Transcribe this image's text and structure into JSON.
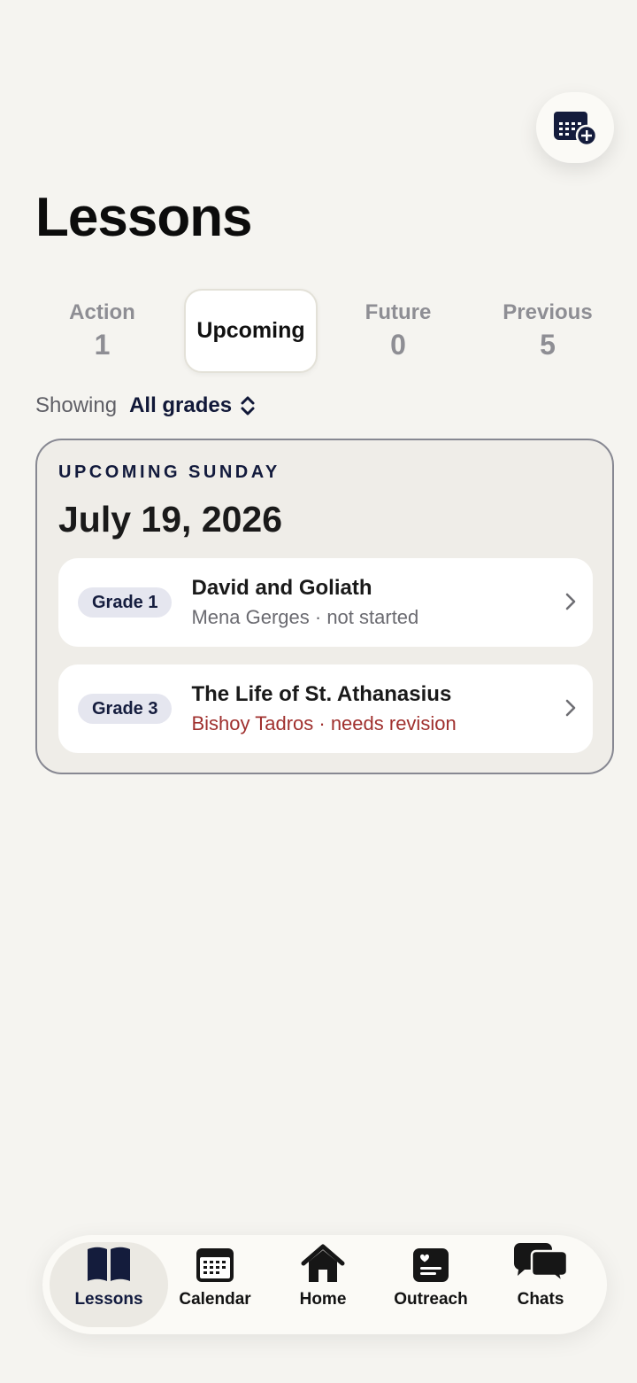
{
  "page": {
    "title": "Lessons"
  },
  "tabs": [
    {
      "label": "Action",
      "count": "1"
    },
    {
      "label": "Upcoming",
      "count": ""
    },
    {
      "label": "Future",
      "count": "0"
    },
    {
      "label": "Previous",
      "count": "5"
    }
  ],
  "filter": {
    "prefix": "Showing",
    "value": "All grades"
  },
  "upcoming": {
    "eyebrow": "UPCOMING SUNDAY",
    "date": "July 19, 2026",
    "lessons": [
      {
        "grade": "Grade 1",
        "title": "David and Goliath",
        "subtitle": "Mena Gerges · not started",
        "status": "not started"
      },
      {
        "grade": "Grade 3",
        "title": "The Life of St. Athanasius",
        "subtitle": "Bishoy Tadros · needs revision",
        "status": "needs revision"
      }
    ]
  },
  "nav": {
    "items": [
      {
        "label": "Lessons",
        "icon": "book-icon"
      },
      {
        "label": "Calendar",
        "icon": "calendar-icon"
      },
      {
        "label": "Home",
        "icon": "home-icon"
      },
      {
        "label": "Outreach",
        "icon": "outreach-icon"
      },
      {
        "label": "Chats",
        "icon": "chat-bubbles-icon"
      }
    ],
    "active": "Lessons"
  },
  "colors": {
    "background": "#f5f4f0",
    "navy": "#151d3e",
    "warning": "#a0302e",
    "inactive_tab": "#8e8e94"
  }
}
